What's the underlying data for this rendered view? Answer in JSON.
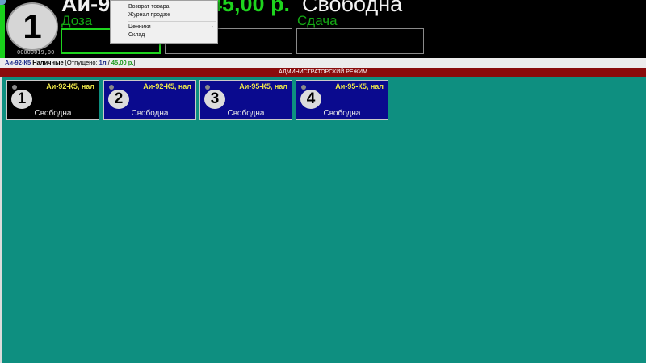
{
  "header": {
    "pump_number": "1",
    "fuel": "Аи-92",
    "price": "45,00 р.",
    "state": "Свободна",
    "dose_label": "Доза",
    "change_label": "Сдача",
    "serial": "00000019,00"
  },
  "status_line": {
    "fuel": "Аи-92-К5",
    "payment": "Наличные",
    "released_label": "[Отпущено:",
    "volume": "1л",
    "sep": "/",
    "amount": "45,00 р.",
    "close": "]"
  },
  "admin_bar": {
    "label": "АДМИНИСТРАТОРСКИЙ РЕЖИМ"
  },
  "pumps": [
    {
      "num": "1",
      "fuel": "Аи-92-К5, нал",
      "state": "Свободна"
    },
    {
      "num": "2",
      "fuel": "Аи-92-К5, нал",
      "state": "Свободна"
    },
    {
      "num": "3",
      "fuel": "Аи-95-К5, нал",
      "state": "Свободна"
    },
    {
      "num": "4",
      "fuel": "Аи-95-К5, нал",
      "state": "Свободна"
    }
  ],
  "context_menu": {
    "items": [
      {
        "label": "Возврат товара"
      },
      {
        "label": "Журнал продаж"
      },
      {
        "label": "Ценники"
      },
      {
        "label": "Склад"
      }
    ],
    "submenu_arrow": "›"
  },
  "colors": {
    "workspace": "#0e8f80",
    "admin_bar": "#8a0c0c",
    "price_green": "#1ed41e",
    "tile_blue": "#0a0a8e",
    "tile_fuel_yellow": "#efe84a"
  }
}
